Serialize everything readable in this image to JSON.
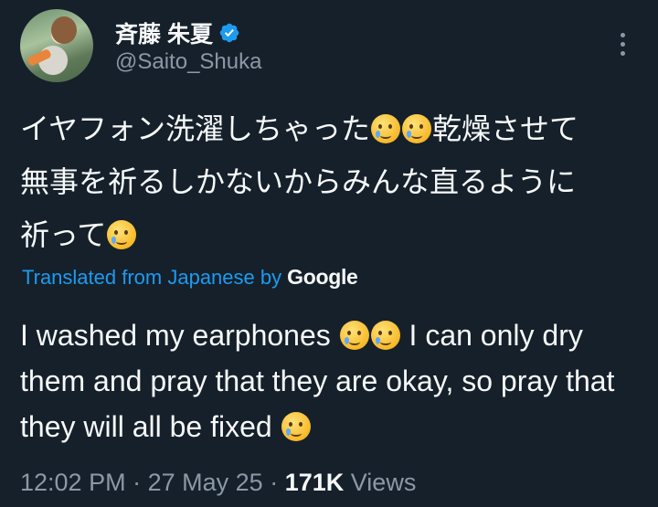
{
  "author": {
    "display_name": "斉藤 朱夏",
    "handle": "@Saito_Shuka",
    "verified": true,
    "verified_color": "#1d9bf0"
  },
  "menu_icon": "more-vertical-icon",
  "tweet": {
    "original": {
      "line1_a": "イヤフォン洗濯しちゃった",
      "line1_b": "乾燥させて",
      "line2": "無事を祈るしかないからみんな直るように",
      "line3": "祈って"
    },
    "translation_note": {
      "label": "Translated from Japanese by",
      "provider": "Google"
    },
    "translated": {
      "part1": "I washed my earphones",
      "part2": "I can only dry them and pray that they are okay, so pray that they will all be fixed"
    },
    "emoji_name": "face-holding-back-tears-emoji"
  },
  "meta": {
    "time": "12:02 PM",
    "separator": "·",
    "date": "27 May 25",
    "views_count": "171K",
    "views_label": "Views"
  },
  "colors": {
    "background": "#15202b",
    "text": "#f7f9f9",
    "secondary": "#8b98a5",
    "link": "#1d9bf0"
  }
}
